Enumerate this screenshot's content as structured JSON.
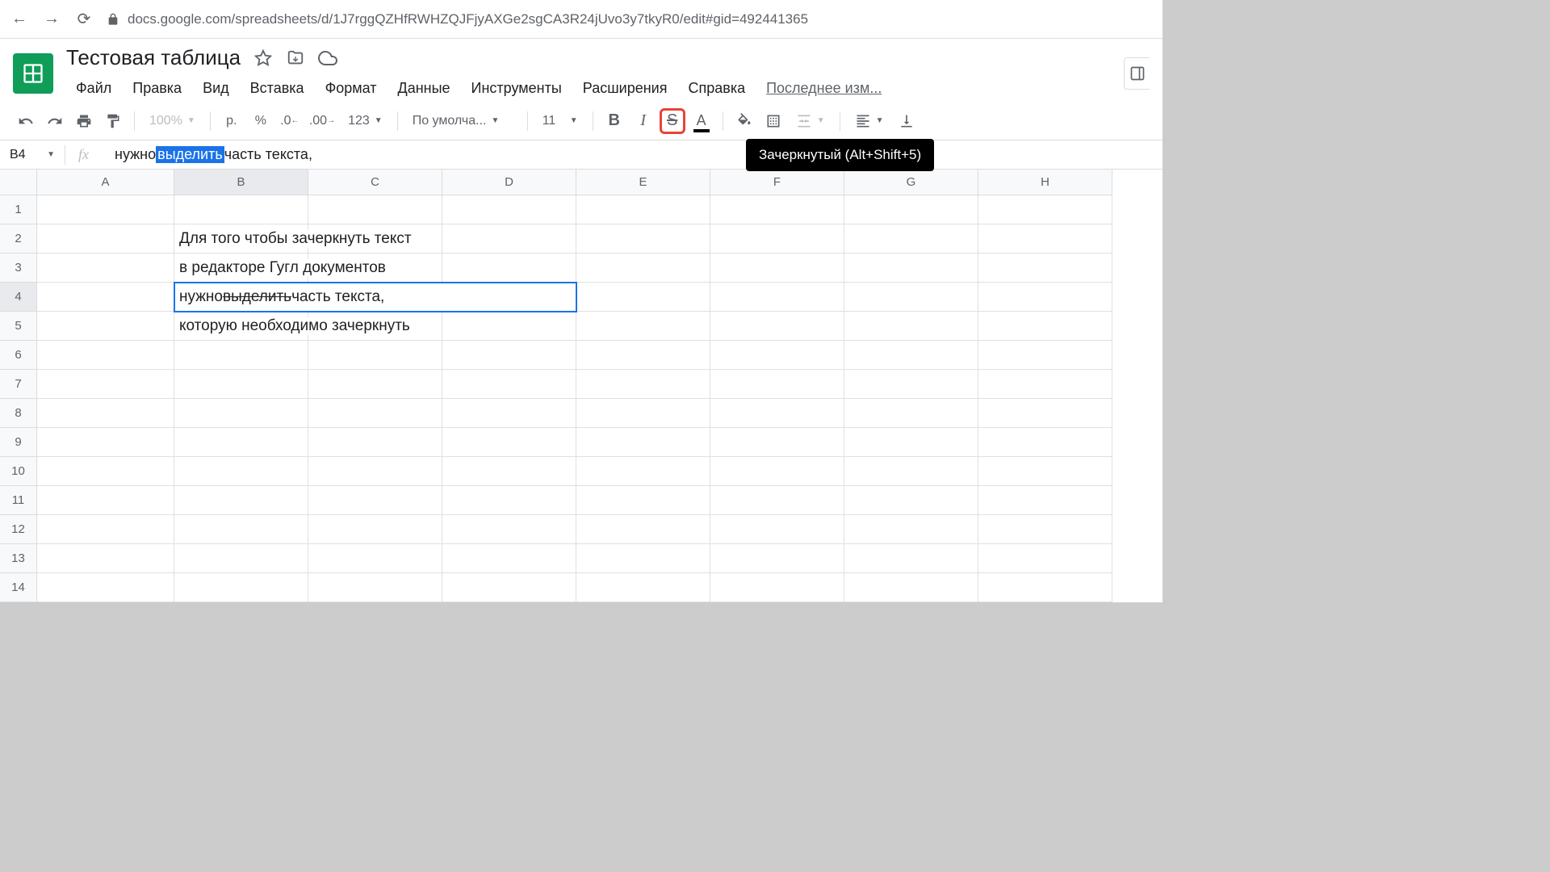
{
  "browser": {
    "url": "docs.google.com/spreadsheets/d/1J7rggQZHfRWHZQJFjyAXGe2sgCA3R24jUvo3y7tkyR0/edit#gid=492441365"
  },
  "document": {
    "title": "Тестовая таблица"
  },
  "menu": {
    "file": "Файл",
    "edit": "Правка",
    "view": "Вид",
    "insert": "Вставка",
    "format": "Формат",
    "data": "Данные",
    "tools": "Инструменты",
    "extensions": "Расширения",
    "help": "Справка",
    "last_edit": "Последнее изм..."
  },
  "toolbar": {
    "zoom": "100%",
    "currency": "р.",
    "percent": "%",
    "decimal_dec": ".0",
    "decimal_inc": ".00",
    "more_formats": "123",
    "font": "По умолча...",
    "font_size": "11",
    "tooltip": "Зачеркнутый (Alt+Shift+5)"
  },
  "formula_bar": {
    "cell_ref": "B4",
    "text_before": "нужно ",
    "text_highlighted": "выделить",
    "text_after": " часть текста,"
  },
  "columns": [
    "A",
    "B",
    "C",
    "D",
    "E",
    "F",
    "G",
    "H"
  ],
  "rows": [
    "1",
    "2",
    "3",
    "4",
    "5",
    "6",
    "7",
    "8",
    "9",
    "10",
    "11",
    "12",
    "13",
    "14"
  ],
  "cells": {
    "B2": "Для того чтобы зачеркнуть текст",
    "B3": "в редакторе Гугл документов",
    "B4_before": "нужно ",
    "B4_strike": "выделить",
    "B4_after": " часть текста,",
    "B5": "которую необходимо зачеркнуть"
  },
  "active_cell": "B4"
}
